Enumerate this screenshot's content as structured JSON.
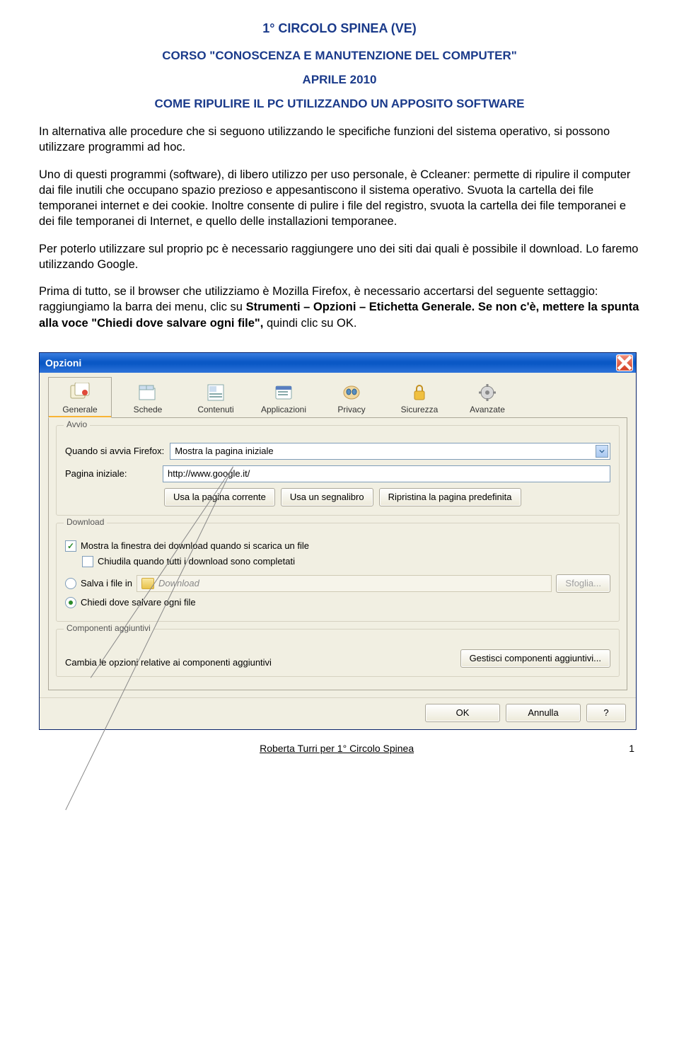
{
  "doc": {
    "title": "1° CIRCOLO SPINEA (VE)",
    "subtitle": "CORSO \"CONOSCENZA E MANUTENZIONE DEL COMPUTER\"",
    "date": "APRILE 2010",
    "heading": "COME RIPULIRE IL PC UTILIZZANDO UN APPOSITO SOFTWARE",
    "p1": "In alternativa alle procedure che si seguono utilizzando le specifiche funzioni del sistema operativo, si possono utilizzare programmi ad hoc.",
    "p2": "Uno di questi programmi (software), di libero utilizzo per uso personale, è Ccleaner: permette di ripulire il computer dai file inutili che occupano spazio prezioso e appesantiscono il sistema operativo. Svuota la cartella dei file temporanei internet e dei cookie. Inoltre consente di pulire i file del registro, svuota la cartella dei file temporanei e dei file temporanei di Internet, e quello delle installazioni temporanee.",
    "p3": "Per poterlo utilizzare sul proprio pc è necessario raggiungere uno dei siti dai quali è possibile il download. Lo faremo utilizzando Google.",
    "p4a": "Prima di tutto, se il browser che utilizziamo è Mozilla Firefox, è necessario accertarsi del seguente settaggio: raggiungiamo la barra dei menu, clic su ",
    "p4b": "Strumenti – Opzioni – Etichetta Generale. Se non c'è, mettere la spunta alla voce \"Chiedi dove salvare ogni file\", ",
    "p4c": "quindi clic su OK."
  },
  "win": {
    "title": "Opzioni",
    "tabs": [
      {
        "label": "Generale"
      },
      {
        "label": "Schede"
      },
      {
        "label": "Contenuti"
      },
      {
        "label": "Applicazioni"
      },
      {
        "label": "Privacy"
      },
      {
        "label": "Sicurezza"
      },
      {
        "label": "Avanzate"
      }
    ],
    "groups": {
      "avvio": {
        "title": "Avvio",
        "startup_label": "Quando si avvia Firefox:",
        "startup_value": "Mostra la pagina iniziale",
        "home_label": "Pagina iniziale:",
        "home_value": "http://www.google.it/",
        "btn1": "Usa la pagina corrente",
        "btn2": "Usa un segnalibro",
        "btn3": "Ripristina la pagina predefinita"
      },
      "download": {
        "title": "Download",
        "chk1": "Mostra la finestra dei download quando si scarica un file",
        "chk2": "Chiudila quando tutti i download sono completati",
        "radio_save": "Salva i file in",
        "folder": "Download",
        "browse": "Sfoglia...",
        "radio_ask": "Chiedi dove salvare ogni file"
      },
      "addons": {
        "title": "Componenti aggiuntivi",
        "desc": "Cambia le opzioni relative ai componenti aggiuntivi",
        "btn": "Gestisci componenti aggiuntivi..."
      }
    },
    "buttons": {
      "ok": "OK",
      "cancel": "Annulla",
      "help": "?"
    }
  },
  "footer": {
    "author": "Roberta Turri per 1° Circolo Spinea",
    "page": "1"
  }
}
